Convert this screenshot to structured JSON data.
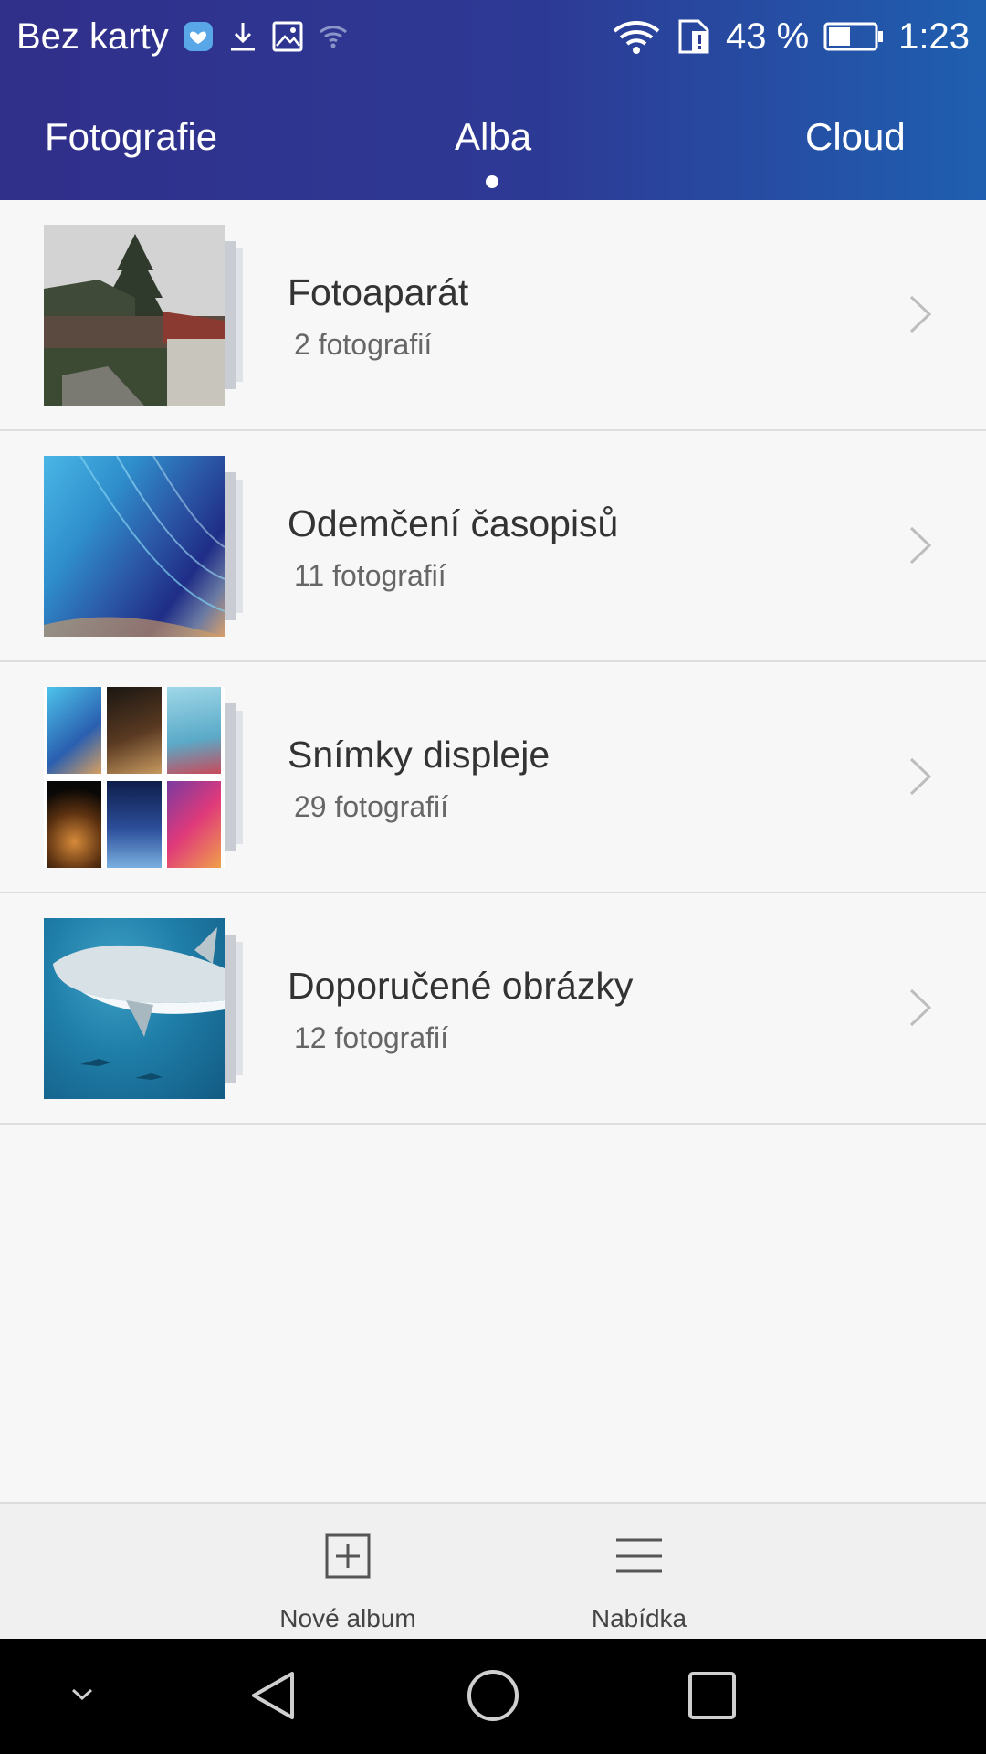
{
  "status_bar": {
    "carrier": "Bez karty",
    "battery": "43 %",
    "time": "1:23",
    "icons": [
      "health-icon",
      "download-icon",
      "image-icon",
      "wifi-question-icon",
      "wifi-icon",
      "sim-alert-icon",
      "battery-icon"
    ]
  },
  "tabs": [
    {
      "label": "Fotografie"
    },
    {
      "label": "Alba",
      "selected": true
    },
    {
      "label": "Cloud"
    }
  ],
  "albums": [
    {
      "title": "Fotoaparát",
      "count": "2 fotografií"
    },
    {
      "title": "Odemčení časopisů",
      "count": "11 fotografií"
    },
    {
      "title": "Snímky displeje",
      "count": "29 fotografií"
    },
    {
      "title": "Doporučené obrázky",
      "count": "12 fotografií"
    }
  ],
  "toolbar": {
    "new_album": "Nové album",
    "menu": "Nabídka"
  },
  "colors": {
    "header_start": "#302f8a",
    "header_end": "#1f5fb0",
    "background": "#f7f7f7"
  }
}
